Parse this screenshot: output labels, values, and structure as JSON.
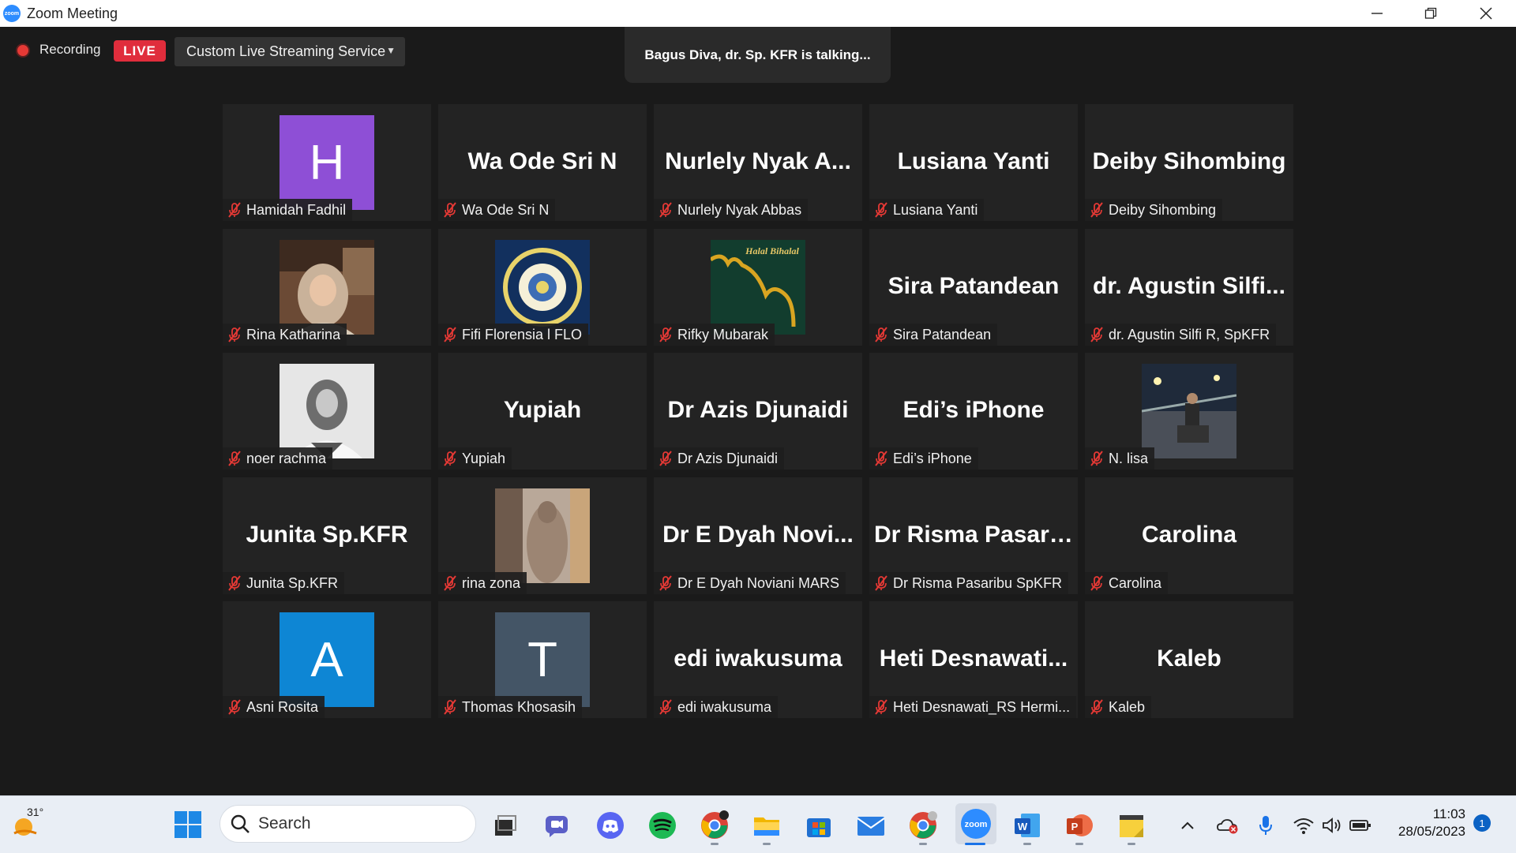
{
  "window": {
    "title": "Zoom Meeting",
    "logo_text": "zoom"
  },
  "topbar": {
    "recording_label": "Recording",
    "live_badge": "LIVE",
    "stream_service": "Custom Live Streaming Service",
    "talking_banner": "Bagus Diva, dr. Sp. KFR is talking..."
  },
  "participants": [
    {
      "tile_name": "",
      "name_tag": "Hamidah Fadhil",
      "avatar": "letter",
      "letter": "H",
      "avatar_color": "#8E4FD6"
    },
    {
      "tile_name": "Wa Ode Sri N",
      "name_tag": "Wa Ode Sri N"
    },
    {
      "tile_name": "Nurlely Nyak A...",
      "name_tag": "Nurlely Nyak Abbas"
    },
    {
      "tile_name": "Lusiana Yanti",
      "name_tag": "Lusiana Yanti"
    },
    {
      "tile_name": "Deiby Sihombing",
      "name_tag": "Deiby Sihombing"
    },
    {
      "tile_name": "",
      "name_tag": "Rina Katharina",
      "avatar": "photo-woman-hijab"
    },
    {
      "tile_name": "",
      "name_tag": "Fifi Florensia l FLO",
      "avatar": "university-seal"
    },
    {
      "tile_name": "",
      "name_tag": "Rifky Mubarak",
      "avatar": "halal-bihalal",
      "picture_text": "Halal Bihalal"
    },
    {
      "tile_name": "Sira Patandean",
      "name_tag": "Sira Patandean"
    },
    {
      "tile_name": "dr. Agustin Silfi...",
      "name_tag": "dr. Agustin Silfi R, SpKFR"
    },
    {
      "tile_name": "",
      "name_tag": "noer rachma",
      "avatar": "photo-portrait-bw"
    },
    {
      "tile_name": "Yupiah",
      "name_tag": "Yupiah"
    },
    {
      "tile_name": "Dr Azis Djunaidi",
      "name_tag": "Dr Azis Djunaidi"
    },
    {
      "tile_name": "Edi’s iPhone",
      "name_tag": "Edi’s iPhone"
    },
    {
      "tile_name": "",
      "name_tag": "N. lisa",
      "avatar": "photo-night-street"
    },
    {
      "tile_name": "Junita Sp.KFR",
      "name_tag": "Junita Sp.KFR"
    },
    {
      "tile_name": "",
      "name_tag": "rina zona",
      "avatar": "photo-window-figure"
    },
    {
      "tile_name": "Dr E Dyah Novi...",
      "name_tag": "Dr E Dyah Noviani MARS"
    },
    {
      "tile_name": "Dr Risma Pasari...",
      "name_tag": "Dr Risma Pasaribu SpKFR"
    },
    {
      "tile_name": "Carolina",
      "name_tag": "Carolina"
    },
    {
      "tile_name": "",
      "name_tag": "Asni Rosita",
      "avatar": "letter",
      "letter": "A",
      "avatar_color": "#0E86D4"
    },
    {
      "tile_name": "",
      "name_tag": "Thomas Khosasih",
      "avatar": "letter",
      "letter": "T",
      "avatar_color": "#445566"
    },
    {
      "tile_name": "edi iwakusuma",
      "name_tag": "edi iwakusuma"
    },
    {
      "tile_name": "Heti  Desnawati...",
      "name_tag": "Heti Desnawati_RS Hermi..."
    },
    {
      "tile_name": "Kaleb",
      "name_tag": "Kaleb"
    }
  ],
  "colors": {
    "muted_mic": "#e53935",
    "live": "#e02d3c",
    "zoom_blue": "#2D8CFF"
  },
  "taskbar": {
    "weather_temp": "31°",
    "search_placeholder": "Search",
    "clock_time": "11:03",
    "clock_date": "28/05/2023",
    "notification_count": "1",
    "apps": [
      "start-icon",
      "task-view-icon",
      "teams-chat-icon",
      "discord-icon",
      "spotify-icon",
      "chrome-icon",
      "file-explorer-icon",
      "microsoft-store-icon",
      "mail-icon",
      "chrome-profile-icon",
      "zoom-icon",
      "word-icon",
      "powerpoint-icon",
      "sticky-notes-icon"
    ],
    "tray": [
      "chevron-up-icon",
      "onedrive-icon",
      "microphone-icon",
      "wifi-icon",
      "speaker-icon",
      "battery-icon"
    ]
  }
}
